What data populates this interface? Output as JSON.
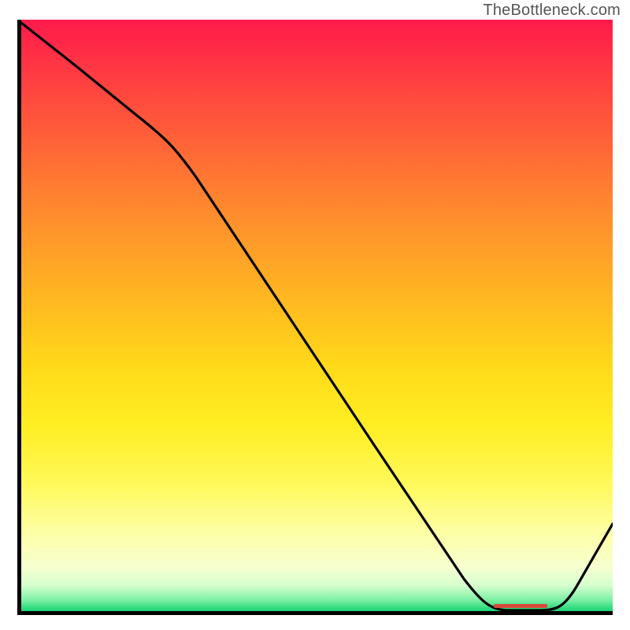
{
  "attribution": "TheBottleneck.com",
  "colors": {
    "curve_stroke": "#000000",
    "marker_fill": "#d84a3a",
    "axis_stroke": "#000000"
  },
  "chart_data": {
    "type": "line",
    "title": "",
    "xlabel": "",
    "ylabel": "",
    "xlim": [
      0,
      100
    ],
    "ylim": [
      0,
      100
    ],
    "background": "heatmap-gradient-vertical",
    "background_gradient_stops": [
      {
        "pos": 0,
        "color": "#ff1a4b"
      },
      {
        "pos": 50,
        "color": "#ffd91a"
      },
      {
        "pos": 90,
        "color": "#fdffa5"
      },
      {
        "pos": 100,
        "color": "#14c96c"
      }
    ],
    "series": [
      {
        "name": "bottleneck-curve",
        "x": [
          0,
          10,
          20,
          25,
          35,
          45,
          55,
          65,
          75,
          80,
          85,
          90,
          100
        ],
        "values": [
          100,
          92,
          84,
          80,
          65,
          50,
          35,
          20,
          5,
          1,
          0,
          1,
          15
        ]
      }
    ],
    "markers": [
      {
        "name": "optimal-range",
        "x_start": 80,
        "x_end": 89,
        "y": 1.5
      }
    ]
  }
}
